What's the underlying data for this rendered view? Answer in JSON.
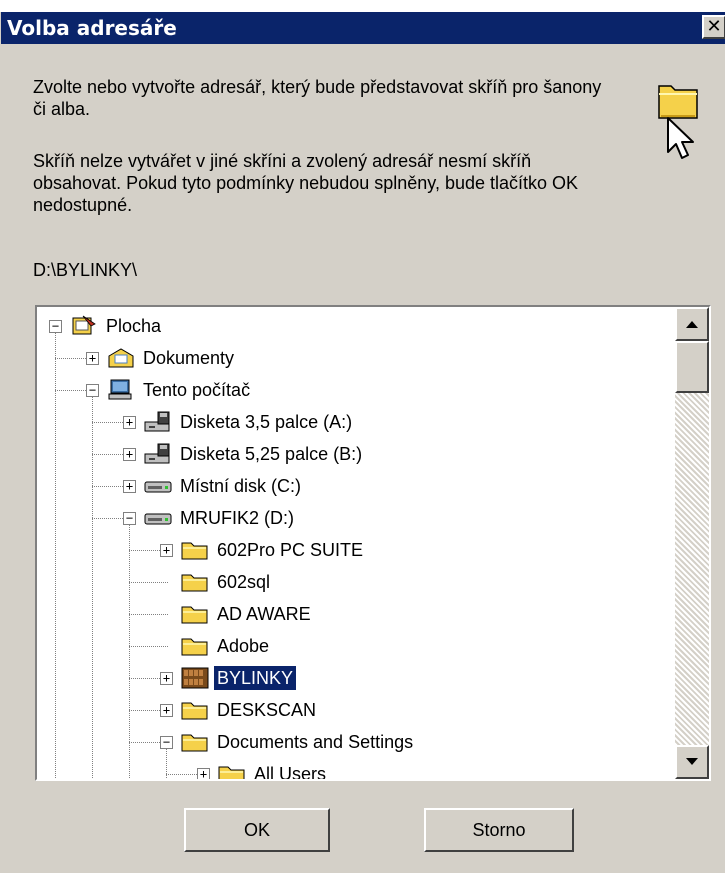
{
  "window": {
    "title": "Volba adresáře",
    "close_label": "✕"
  },
  "info": {
    "paragraph1": "Zvolte nebo vytvořte adresář, který bude představovat skříň pro šanony či alba.",
    "paragraph2": "Skříň nelze vytvářet v jiné skříni a zvolený adresář nesmí skříň obsahovat. Pokud tyto podmínky nebudou splněny, bude tlačítko OK nedostupné.",
    "selected_path": "D:\\BYLINKY\\"
  },
  "tree": {
    "nodes": [
      {
        "label": "Plocha",
        "icon": "desktop-icon",
        "expanded": true
      },
      {
        "label": "Dokumenty",
        "icon": "my-documents-icon",
        "expanded": false
      },
      {
        "label": "Tento počítač",
        "icon": "my-computer-icon",
        "expanded": true
      },
      {
        "label": "Disketa 3,5 palce (A:)",
        "icon": "floppy-drive-icon",
        "expanded": false
      },
      {
        "label": "Disketa 5,25 palce (B:)",
        "icon": "floppy-drive-icon",
        "expanded": false
      },
      {
        "label": "Místní disk (C:)",
        "icon": "hard-drive-icon",
        "expanded": false
      },
      {
        "label": "MRUFIK2 (D:)",
        "icon": "hard-drive-icon",
        "expanded": true
      },
      {
        "label": "602Pro PC SUITE",
        "icon": "folder-icon",
        "expanded": false
      },
      {
        "label": "602sql",
        "icon": "folder-icon"
      },
      {
        "label": "AD AWARE",
        "icon": "folder-icon"
      },
      {
        "label": "Adobe",
        "icon": "folder-icon"
      },
      {
        "label": "BYLINKY",
        "icon": "cabinet-folder-icon",
        "expanded": false,
        "selected": true
      },
      {
        "label": "DESKSCAN",
        "icon": "folder-icon",
        "expanded": false
      },
      {
        "label": "Documents and Settings",
        "icon": "folder-icon",
        "expanded": true
      },
      {
        "label": "All Users",
        "icon": "folder-icon",
        "expanded": false
      }
    ]
  },
  "buttons": {
    "ok": "OK",
    "cancel": "Storno"
  },
  "colors": {
    "titlebar": "#0a246a",
    "dialog_bg": "#d4d0c8",
    "selection": "#0a246a",
    "folder": "#f5d14a"
  }
}
